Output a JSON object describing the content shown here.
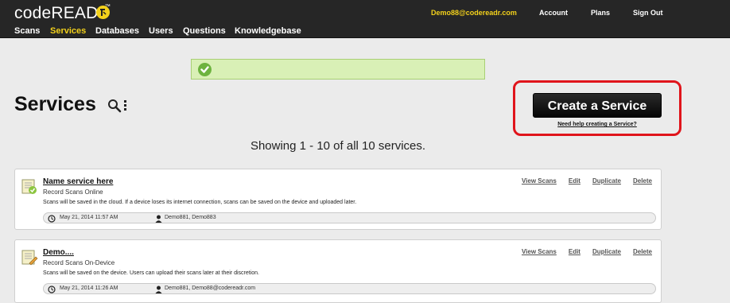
{
  "header": {
    "logo_text": "codeREADr",
    "logo_tm": "™",
    "nav": [
      "Scans",
      "Services",
      "Databases",
      "Users",
      "Questions",
      "Knowledgebase"
    ],
    "active_nav": "Services",
    "user_email": "Demo88@codereadr.com",
    "account_label": "Account",
    "plans_label": "Plans",
    "signout_label": "Sign Out",
    "colors": {
      "bar": "#262626",
      "accent": "#f3d11b"
    }
  },
  "flash": {
    "icon": "checkmark-icon",
    "color": "#d9f0b6"
  },
  "page": {
    "title": "Services",
    "create_button": "Create a Service",
    "help_link": "Need help creating a Service?",
    "showing_text": "Showing 1 - 10 of all 10 services.",
    "highlight_color": "#e0141b"
  },
  "services": [
    {
      "title": "Name service here",
      "mode": "Record Scans Online",
      "description": "Scans will be saved in the cloud. If a device loses its internet connection, scans can be saved on the device and uploaded later.",
      "date": "May 21, 2014 11:57 AM",
      "users": "Demo881, Demo883",
      "actions": [
        "View Scans",
        "Edit",
        "Duplicate",
        "Delete"
      ]
    },
    {
      "title": "Demo....",
      "mode": "Record Scans On-Device",
      "description": "Scans will be saved on the device. Users can upload their scans later at their discretion.",
      "date": "May 21, 2014 11:26 AM",
      "users": "Demo881, Demo88@codereadr.com",
      "actions": [
        "View Scans",
        "Edit",
        "Duplicate",
        "Delete"
      ]
    }
  ]
}
